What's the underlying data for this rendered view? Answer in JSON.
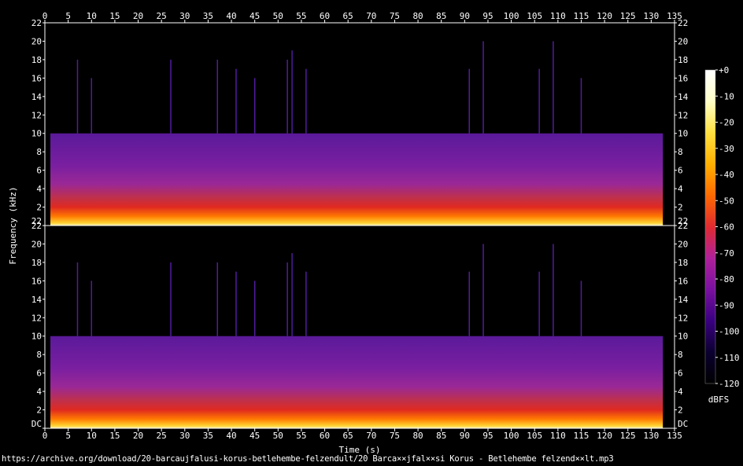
{
  "chart_data": {
    "type": "heatmap",
    "title": "",
    "xlabel": "Time (s)",
    "ylabel": "Frequency (kHz)",
    "channels": [
      "top",
      "bottom"
    ],
    "x_ticks": [
      "0",
      "5",
      "10",
      "15",
      "20",
      "25",
      "30",
      "35",
      "40",
      "45",
      "50",
      "55",
      "60",
      "65",
      "70",
      "75",
      "80",
      "85",
      "90",
      "95",
      "100",
      "105",
      "110",
      "115",
      "120",
      "125",
      "130",
      "135"
    ],
    "x_tick_values": [
      0,
      5,
      10,
      15,
      20,
      25,
      30,
      35,
      40,
      45,
      50,
      55,
      60,
      65,
      70,
      75,
      80,
      85,
      90,
      95,
      100,
      105,
      110,
      115,
      120,
      125,
      130,
      135
    ],
    "xlim": [
      0,
      135
    ],
    "y_ticks_top": [
      "22",
      "20",
      "18",
      "16",
      "14",
      "12",
      "10",
      "8",
      "6",
      "4",
      "2",
      "22"
    ],
    "y_tick_values_top": [
      22,
      20,
      18,
      16,
      14,
      12,
      10,
      8,
      6,
      4,
      2,
      0
    ],
    "y_ticks_bottom": [
      "22",
      "20",
      "18",
      "16",
      "14",
      "12",
      "10",
      "8",
      "6",
      "4",
      "2",
      "DC"
    ],
    "y_tick_values_bottom": [
      22,
      20,
      18,
      16,
      14,
      12,
      10,
      8,
      6,
      4,
      2,
      0
    ],
    "ylim": [
      0,
      22
    ],
    "audio_duration_s": 132.5,
    "lowpass_cutoff_khz": 10,
    "transient_times_s": [
      7,
      10,
      27,
      37,
      41,
      45,
      52,
      53,
      56,
      91,
      94,
      106,
      109,
      115
    ],
    "colorbar": {
      "label": "dBFS",
      "ticks": [
        "+0",
        "-10",
        "-20",
        "-30",
        "-40",
        "-50",
        "-60",
        "-70",
        "-80",
        "-90",
        "-100",
        "-110",
        "-120"
      ],
      "tick_values": [
        0,
        -10,
        -20,
        -30,
        -40,
        -50,
        -60,
        -70,
        -80,
        -90,
        -100,
        -110,
        -120
      ],
      "range": [
        -120,
        0
      ],
      "colors": [
        "#000000",
        "#0b0030",
        "#3a0080",
        "#7a10a0",
        "#b0209a",
        "#e02a30",
        "#ff6a00",
        "#ffb000",
        "#ffe040",
        "#ffffc8",
        "#ffffff"
      ]
    }
  },
  "footer": {
    "file_path": "https://archive.org/download/20-barcaujfalusi-korus-betlehembe-felzendult/20 Barca××jfal××si Korus - Betlehembe felzend××lt.mp3"
  }
}
